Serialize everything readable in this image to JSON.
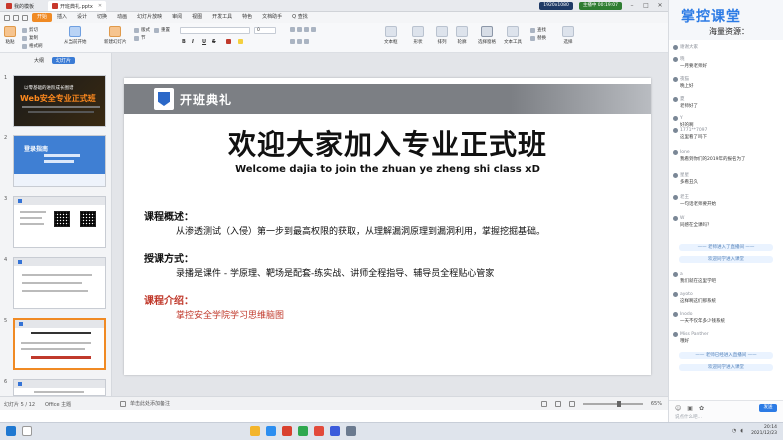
{
  "titlebar": {
    "tabs": [
      {
        "label": "我的模板"
      },
      {
        "label": "开班典礼.pptx"
      }
    ],
    "resolution": "1920x1080",
    "live_status": "主播中 00:19:07"
  },
  "menubar": {
    "items": [
      "开始",
      "插入",
      "设计",
      "切换",
      "动画",
      "幻灯片放映",
      "审阅",
      "视图",
      "开发工具",
      "特色",
      "文档助手",
      "Q 查找"
    ],
    "active_index": 0
  },
  "ribbon": {
    "paste": "粘贴",
    "cut": "剪切",
    "copy": "复制",
    "format_painter": "格式刷",
    "from_current": "从当前开始",
    "new_slide": "新建幻灯片",
    "layout": "版式",
    "section": "节",
    "reset": "重置",
    "font_value": "",
    "size_value": "0",
    "bold": "B",
    "italic": "I",
    "underline": "U",
    "strike": "S",
    "textbox": "文本框",
    "shape": "形状",
    "arrange": "排列",
    "outline": "轮廓",
    "select_pane": "选择窗格",
    "text_tools": "文本工具",
    "find": "查找",
    "replace": "替换",
    "select": "选择"
  },
  "thumbpanel": {
    "tab_outline": "大纲",
    "tab_slides": "幻灯片",
    "numbers": [
      "1",
      "2",
      "3",
      "4",
      "5",
      "6"
    ],
    "slide1_line1": "以零基础的进阶成长图谱",
    "slide1_line2": "Web安全专业正式班",
    "slide2_title": "登录指南"
  },
  "slide": {
    "banner": "开班典礼",
    "title": "欢迎大家加入专业正式班",
    "subtitle": "Welcome dajia to join the zhuan ye zheng shi class xD",
    "sections": [
      {
        "heading": "课程概述：",
        "body": "从渗透测试（入侵）第一步到最高权限的获取，从理解漏洞原理到漏洞利用，掌握挖掘基础。"
      },
      {
        "heading": "授课方式：",
        "body": "录播是课件 - 学原理、靶场是配套-练实战、讲师全程指导、辅导员全程贴心管家"
      },
      {
        "heading": "课程介绍：",
        "body": "掌控安全学院学习思维脑图"
      }
    ],
    "accent_red": "#c0392b",
    "banner_gray": "#7c7f84",
    "logo_blue": "#2b68c8"
  },
  "statusbar": {
    "slide_count": "幻灯片 5 / 12",
    "theme": "Office 主题",
    "notes": "单击此处添加备注",
    "zoom": "65%"
  },
  "chat": {
    "brand": "掌控课堂",
    "brand_sub": "海量资源：",
    "messages": [
      {
        "who": "谢谢大家",
        "text": ""
      },
      {
        "who": "晓",
        "text": "一月要老师好"
      },
      {
        "who": "夜猫",
        "text": "晚上好"
      },
      {
        "who": "夏",
        "text": "老师好了"
      },
      {
        "who": "Y",
        "text": "好的啊"
      },
      {
        "who": "lone",
        "text": "来了"
      },
      {
        "who": "1771**7097",
        "text": "这里看了吗下"
      },
      {
        "who": "小鱼",
        "text": "我看到你们的2019年的报名为了"
      },
      {
        "who": "星星",
        "text": "多看丑久"
      },
      {
        "who": "老王",
        "text": "一句话老师要开始"
      },
      {
        "who": "W",
        "text": "同感在全课吗？"
      },
      {
        "who": "a",
        "text": "我们就在这里学吧"
      },
      {
        "who": "ayoto",
        "text": "这样啊这们那系统"
      },
      {
        "who": "lnodo",
        "text": "一天不仅年多少钱系统"
      },
      {
        "who": "Miss Panther",
        "text": "哦好"
      }
    ],
    "system_notes": [
      "—— 老师进入了直播间 ——",
      "欢迎同学进入课堂",
      "—— 老师已经进入直播间 ——",
      "欢迎同学进入课堂"
    ],
    "send": "发送",
    "hint": "说点什么吧…"
  },
  "taskbar": {
    "time": "20:14",
    "date": "2021/12/23"
  }
}
